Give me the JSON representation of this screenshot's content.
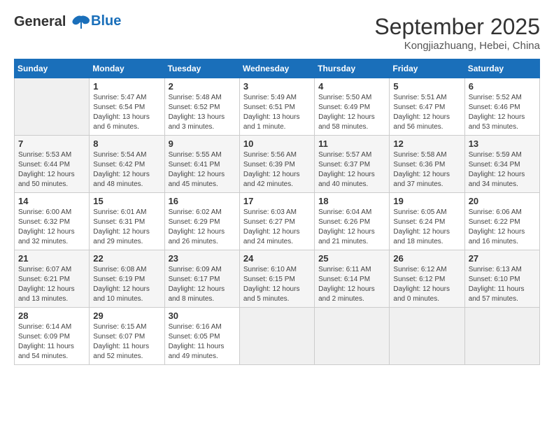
{
  "header": {
    "logo_line1": "General",
    "logo_line2": "Blue",
    "month": "September 2025",
    "location": "Kongjiazhuang, Hebei, China"
  },
  "days_of_week": [
    "Sunday",
    "Monday",
    "Tuesday",
    "Wednesday",
    "Thursday",
    "Friday",
    "Saturday"
  ],
  "weeks": [
    [
      {
        "day": "",
        "empty": true
      },
      {
        "day": "1",
        "sunrise": "5:47 AM",
        "sunset": "6:54 PM",
        "daylight": "13 hours and 6 minutes."
      },
      {
        "day": "2",
        "sunrise": "5:48 AM",
        "sunset": "6:52 PM",
        "daylight": "13 hours and 3 minutes."
      },
      {
        "day": "3",
        "sunrise": "5:49 AM",
        "sunset": "6:51 PM",
        "daylight": "13 hours and 1 minute."
      },
      {
        "day": "4",
        "sunrise": "5:50 AM",
        "sunset": "6:49 PM",
        "daylight": "12 hours and 58 minutes."
      },
      {
        "day": "5",
        "sunrise": "5:51 AM",
        "sunset": "6:47 PM",
        "daylight": "12 hours and 56 minutes."
      },
      {
        "day": "6",
        "sunrise": "5:52 AM",
        "sunset": "6:46 PM",
        "daylight": "12 hours and 53 minutes."
      }
    ],
    [
      {
        "day": "7",
        "sunrise": "5:53 AM",
        "sunset": "6:44 PM",
        "daylight": "12 hours and 50 minutes."
      },
      {
        "day": "8",
        "sunrise": "5:54 AM",
        "sunset": "6:42 PM",
        "daylight": "12 hours and 48 minutes."
      },
      {
        "day": "9",
        "sunrise": "5:55 AM",
        "sunset": "6:41 PM",
        "daylight": "12 hours and 45 minutes."
      },
      {
        "day": "10",
        "sunrise": "5:56 AM",
        "sunset": "6:39 PM",
        "daylight": "12 hours and 42 minutes."
      },
      {
        "day": "11",
        "sunrise": "5:57 AM",
        "sunset": "6:37 PM",
        "daylight": "12 hours and 40 minutes."
      },
      {
        "day": "12",
        "sunrise": "5:58 AM",
        "sunset": "6:36 PM",
        "daylight": "12 hours and 37 minutes."
      },
      {
        "day": "13",
        "sunrise": "5:59 AM",
        "sunset": "6:34 PM",
        "daylight": "12 hours and 34 minutes."
      }
    ],
    [
      {
        "day": "14",
        "sunrise": "6:00 AM",
        "sunset": "6:32 PM",
        "daylight": "12 hours and 32 minutes."
      },
      {
        "day": "15",
        "sunrise": "6:01 AM",
        "sunset": "6:31 PM",
        "daylight": "12 hours and 29 minutes."
      },
      {
        "day": "16",
        "sunrise": "6:02 AM",
        "sunset": "6:29 PM",
        "daylight": "12 hours and 26 minutes."
      },
      {
        "day": "17",
        "sunrise": "6:03 AM",
        "sunset": "6:27 PM",
        "daylight": "12 hours and 24 minutes."
      },
      {
        "day": "18",
        "sunrise": "6:04 AM",
        "sunset": "6:26 PM",
        "daylight": "12 hours and 21 minutes."
      },
      {
        "day": "19",
        "sunrise": "6:05 AM",
        "sunset": "6:24 PM",
        "daylight": "12 hours and 18 minutes."
      },
      {
        "day": "20",
        "sunrise": "6:06 AM",
        "sunset": "6:22 PM",
        "daylight": "12 hours and 16 minutes."
      }
    ],
    [
      {
        "day": "21",
        "sunrise": "6:07 AM",
        "sunset": "6:21 PM",
        "daylight": "12 hours and 13 minutes."
      },
      {
        "day": "22",
        "sunrise": "6:08 AM",
        "sunset": "6:19 PM",
        "daylight": "12 hours and 10 minutes."
      },
      {
        "day": "23",
        "sunrise": "6:09 AM",
        "sunset": "6:17 PM",
        "daylight": "12 hours and 8 minutes."
      },
      {
        "day": "24",
        "sunrise": "6:10 AM",
        "sunset": "6:15 PM",
        "daylight": "12 hours and 5 minutes."
      },
      {
        "day": "25",
        "sunrise": "6:11 AM",
        "sunset": "6:14 PM",
        "daylight": "12 hours and 2 minutes."
      },
      {
        "day": "26",
        "sunrise": "6:12 AM",
        "sunset": "6:12 PM",
        "daylight": "12 hours and 0 minutes."
      },
      {
        "day": "27",
        "sunrise": "6:13 AM",
        "sunset": "6:10 PM",
        "daylight": "11 hours and 57 minutes."
      }
    ],
    [
      {
        "day": "28",
        "sunrise": "6:14 AM",
        "sunset": "6:09 PM",
        "daylight": "11 hours and 54 minutes."
      },
      {
        "day": "29",
        "sunrise": "6:15 AM",
        "sunset": "6:07 PM",
        "daylight": "11 hours and 52 minutes."
      },
      {
        "day": "30",
        "sunrise": "6:16 AM",
        "sunset": "6:05 PM",
        "daylight": "11 hours and 49 minutes."
      },
      {
        "day": "",
        "empty": true
      },
      {
        "day": "",
        "empty": true
      },
      {
        "day": "",
        "empty": true
      },
      {
        "day": "",
        "empty": true
      }
    ]
  ]
}
